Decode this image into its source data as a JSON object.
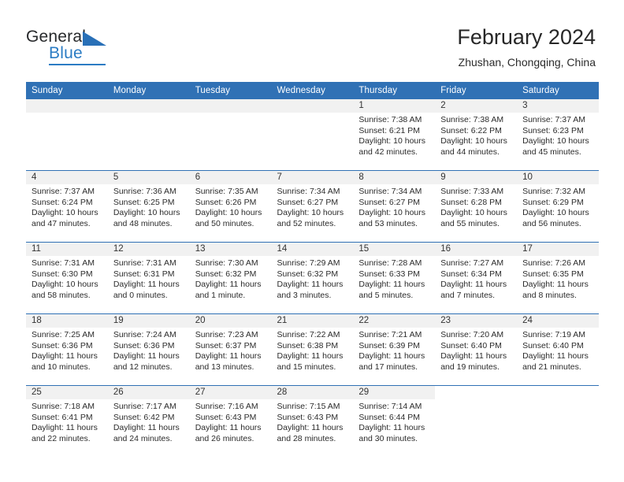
{
  "logo": {
    "word_one": "General",
    "word_two": "Blue",
    "triangle_color": "#2970b7",
    "blue_color": "#2b7cc4"
  },
  "header": {
    "title": "February 2024",
    "subtitle": "Zhushan, Chongqing, China",
    "accent_color": "#3071b5",
    "band_color": "#f1f1f1"
  },
  "weekday_headers": [
    "Sunday",
    "Monday",
    "Tuesday",
    "Wednesday",
    "Thursday",
    "Friday",
    "Saturday"
  ],
  "weeks": [
    [
      {
        "date": "",
        "blank": true,
        "sunrise": "",
        "sunset": "",
        "daylight_line1": "",
        "daylight_line2": ""
      },
      {
        "date": "",
        "blank": true,
        "sunrise": "",
        "sunset": "",
        "daylight_line1": "",
        "daylight_line2": ""
      },
      {
        "date": "",
        "blank": true,
        "sunrise": "",
        "sunset": "",
        "daylight_line1": "",
        "daylight_line2": ""
      },
      {
        "date": "",
        "blank": true,
        "sunrise": "",
        "sunset": "",
        "daylight_line1": "",
        "daylight_line2": ""
      },
      {
        "date": "1",
        "blank": false,
        "sunrise": "Sunrise: 7:38 AM",
        "sunset": "Sunset: 6:21 PM",
        "daylight_line1": "Daylight: 10 hours",
        "daylight_line2": "and 42 minutes."
      },
      {
        "date": "2",
        "blank": false,
        "sunrise": "Sunrise: 7:38 AM",
        "sunset": "Sunset: 6:22 PM",
        "daylight_line1": "Daylight: 10 hours",
        "daylight_line2": "and 44 minutes."
      },
      {
        "date": "3",
        "blank": false,
        "sunrise": "Sunrise: 7:37 AM",
        "sunset": "Sunset: 6:23 PM",
        "daylight_line1": "Daylight: 10 hours",
        "daylight_line2": "and 45 minutes."
      }
    ],
    [
      {
        "date": "4",
        "blank": false,
        "sunrise": "Sunrise: 7:37 AM",
        "sunset": "Sunset: 6:24 PM",
        "daylight_line1": "Daylight: 10 hours",
        "daylight_line2": "and 47 minutes."
      },
      {
        "date": "5",
        "blank": false,
        "sunrise": "Sunrise: 7:36 AM",
        "sunset": "Sunset: 6:25 PM",
        "daylight_line1": "Daylight: 10 hours",
        "daylight_line2": "and 48 minutes."
      },
      {
        "date": "6",
        "blank": false,
        "sunrise": "Sunrise: 7:35 AM",
        "sunset": "Sunset: 6:26 PM",
        "daylight_line1": "Daylight: 10 hours",
        "daylight_line2": "and 50 minutes."
      },
      {
        "date": "7",
        "blank": false,
        "sunrise": "Sunrise: 7:34 AM",
        "sunset": "Sunset: 6:27 PM",
        "daylight_line1": "Daylight: 10 hours",
        "daylight_line2": "and 52 minutes."
      },
      {
        "date": "8",
        "blank": false,
        "sunrise": "Sunrise: 7:34 AM",
        "sunset": "Sunset: 6:27 PM",
        "daylight_line1": "Daylight: 10 hours",
        "daylight_line2": "and 53 minutes."
      },
      {
        "date": "9",
        "blank": false,
        "sunrise": "Sunrise: 7:33 AM",
        "sunset": "Sunset: 6:28 PM",
        "daylight_line1": "Daylight: 10 hours",
        "daylight_line2": "and 55 minutes."
      },
      {
        "date": "10",
        "blank": false,
        "sunrise": "Sunrise: 7:32 AM",
        "sunset": "Sunset: 6:29 PM",
        "daylight_line1": "Daylight: 10 hours",
        "daylight_line2": "and 56 minutes."
      }
    ],
    [
      {
        "date": "11",
        "blank": false,
        "sunrise": "Sunrise: 7:31 AM",
        "sunset": "Sunset: 6:30 PM",
        "daylight_line1": "Daylight: 10 hours",
        "daylight_line2": "and 58 minutes."
      },
      {
        "date": "12",
        "blank": false,
        "sunrise": "Sunrise: 7:31 AM",
        "sunset": "Sunset: 6:31 PM",
        "daylight_line1": "Daylight: 11 hours",
        "daylight_line2": "and 0 minutes."
      },
      {
        "date": "13",
        "blank": false,
        "sunrise": "Sunrise: 7:30 AM",
        "sunset": "Sunset: 6:32 PM",
        "daylight_line1": "Daylight: 11 hours",
        "daylight_line2": "and 1 minute."
      },
      {
        "date": "14",
        "blank": false,
        "sunrise": "Sunrise: 7:29 AM",
        "sunset": "Sunset: 6:32 PM",
        "daylight_line1": "Daylight: 11 hours",
        "daylight_line2": "and 3 minutes."
      },
      {
        "date": "15",
        "blank": false,
        "sunrise": "Sunrise: 7:28 AM",
        "sunset": "Sunset: 6:33 PM",
        "daylight_line1": "Daylight: 11 hours",
        "daylight_line2": "and 5 minutes."
      },
      {
        "date": "16",
        "blank": false,
        "sunrise": "Sunrise: 7:27 AM",
        "sunset": "Sunset: 6:34 PM",
        "daylight_line1": "Daylight: 11 hours",
        "daylight_line2": "and 7 minutes."
      },
      {
        "date": "17",
        "blank": false,
        "sunrise": "Sunrise: 7:26 AM",
        "sunset": "Sunset: 6:35 PM",
        "daylight_line1": "Daylight: 11 hours",
        "daylight_line2": "and 8 minutes."
      }
    ],
    [
      {
        "date": "18",
        "blank": false,
        "sunrise": "Sunrise: 7:25 AM",
        "sunset": "Sunset: 6:36 PM",
        "daylight_line1": "Daylight: 11 hours",
        "daylight_line2": "and 10 minutes."
      },
      {
        "date": "19",
        "blank": false,
        "sunrise": "Sunrise: 7:24 AM",
        "sunset": "Sunset: 6:36 PM",
        "daylight_line1": "Daylight: 11 hours",
        "daylight_line2": "and 12 minutes."
      },
      {
        "date": "20",
        "blank": false,
        "sunrise": "Sunrise: 7:23 AM",
        "sunset": "Sunset: 6:37 PM",
        "daylight_line1": "Daylight: 11 hours",
        "daylight_line2": "and 13 minutes."
      },
      {
        "date": "21",
        "blank": false,
        "sunrise": "Sunrise: 7:22 AM",
        "sunset": "Sunset: 6:38 PM",
        "daylight_line1": "Daylight: 11 hours",
        "daylight_line2": "and 15 minutes."
      },
      {
        "date": "22",
        "blank": false,
        "sunrise": "Sunrise: 7:21 AM",
        "sunset": "Sunset: 6:39 PM",
        "daylight_line1": "Daylight: 11 hours",
        "daylight_line2": "and 17 minutes."
      },
      {
        "date": "23",
        "blank": false,
        "sunrise": "Sunrise: 7:20 AM",
        "sunset": "Sunset: 6:40 PM",
        "daylight_line1": "Daylight: 11 hours",
        "daylight_line2": "and 19 minutes."
      },
      {
        "date": "24",
        "blank": false,
        "sunrise": "Sunrise: 7:19 AM",
        "sunset": "Sunset: 6:40 PM",
        "daylight_line1": "Daylight: 11 hours",
        "daylight_line2": "and 21 minutes."
      }
    ],
    [
      {
        "date": "25",
        "blank": false,
        "sunrise": "Sunrise: 7:18 AM",
        "sunset": "Sunset: 6:41 PM",
        "daylight_line1": "Daylight: 11 hours",
        "daylight_line2": "and 22 minutes."
      },
      {
        "date": "26",
        "blank": false,
        "sunrise": "Sunrise: 7:17 AM",
        "sunset": "Sunset: 6:42 PM",
        "daylight_line1": "Daylight: 11 hours",
        "daylight_line2": "and 24 minutes."
      },
      {
        "date": "27",
        "blank": false,
        "sunrise": "Sunrise: 7:16 AM",
        "sunset": "Sunset: 6:43 PM",
        "daylight_line1": "Daylight: 11 hours",
        "daylight_line2": "and 26 minutes."
      },
      {
        "date": "28",
        "blank": false,
        "sunrise": "Sunrise: 7:15 AM",
        "sunset": "Sunset: 6:43 PM",
        "daylight_line1": "Daylight: 11 hours",
        "daylight_line2": "and 28 minutes."
      },
      {
        "date": "29",
        "blank": false,
        "sunrise": "Sunrise: 7:14 AM",
        "sunset": "Sunset: 6:44 PM",
        "daylight_line1": "Daylight: 11 hours",
        "daylight_line2": "and 30 minutes."
      },
      {
        "date": "",
        "blank": true,
        "sunrise": "",
        "sunset": "",
        "daylight_line1": "",
        "daylight_line2": ""
      },
      {
        "date": "",
        "blank": true,
        "sunrise": "",
        "sunset": "",
        "daylight_line1": "",
        "daylight_line2": ""
      }
    ]
  ]
}
